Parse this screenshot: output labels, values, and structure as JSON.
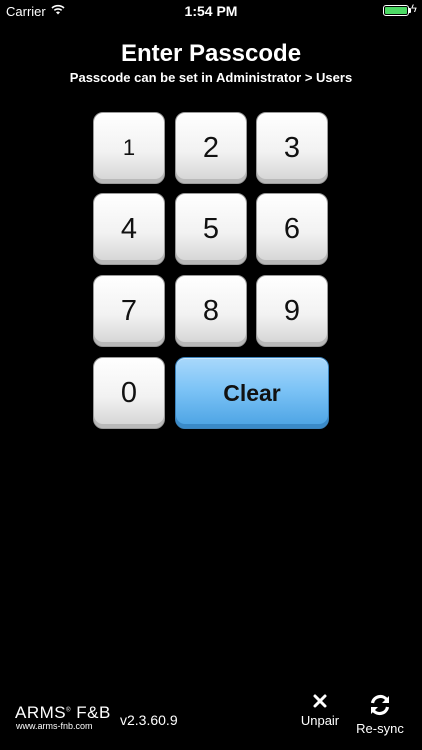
{
  "status_bar": {
    "carrier": "Carrier",
    "time": "1:54 PM",
    "battery_level": 1.0,
    "battery_color": "#4cd964"
  },
  "header": {
    "title": "Enter Passcode",
    "subtitle": "Passcode can be set in Administrator > Users"
  },
  "keypad": {
    "keys": [
      "1",
      "2",
      "3",
      "4",
      "5",
      "6",
      "7",
      "8",
      "9",
      "0"
    ],
    "clear_label": "Clear",
    "clear_color": "#5fb2ef"
  },
  "footer": {
    "brand": "ARMS",
    "brand_suffix": "F&B",
    "brand_url": "www.arms-fnb.com",
    "version": "v2.3.60.9",
    "unpair_label": "Unpair",
    "resync_label": "Re-sync",
    "unpair_icon": "close-icon",
    "resync_icon": "sync-icon"
  }
}
